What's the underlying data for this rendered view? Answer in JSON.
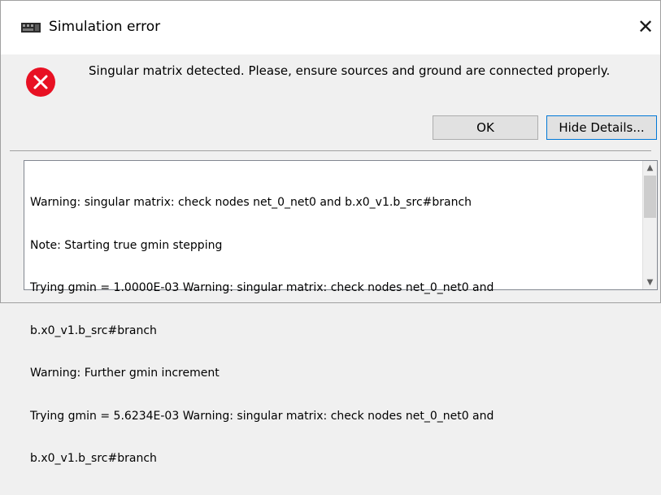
{
  "dialog": {
    "title": "Simulation error",
    "close_symbol": "✕",
    "icons": {
      "app": "simulator-app-icon",
      "close": "close-icon",
      "error": "error-circle-x-icon"
    },
    "colors": {
      "error_red": "#e81123",
      "focus_border": "#0078d7"
    },
    "message": "Singular matrix detected. Please, ensure sources and ground are connected properly."
  },
  "buttons": {
    "ok_label": "OK",
    "details_label": "Hide Details..."
  },
  "details": {
    "lines": [
      "Warning: singular matrix: check nodes net_0_net0 and b.x0_v1.b_src#branch",
      "Note: Starting true gmin stepping",
      "Trying gmin = 1.0000E-03 Warning: singular matrix: check nodes net_0_net0 and",
      "b.x0_v1.b_src#branch",
      "Warning: Further gmin increment",
      "Trying gmin = 5.6234E-03 Warning: singular matrix: check nodes net_0_net0 and",
      "b.x0_v1.b_src#branch"
    ],
    "scroll_up_symbol": "▲",
    "scroll_down_symbol": "▼"
  }
}
